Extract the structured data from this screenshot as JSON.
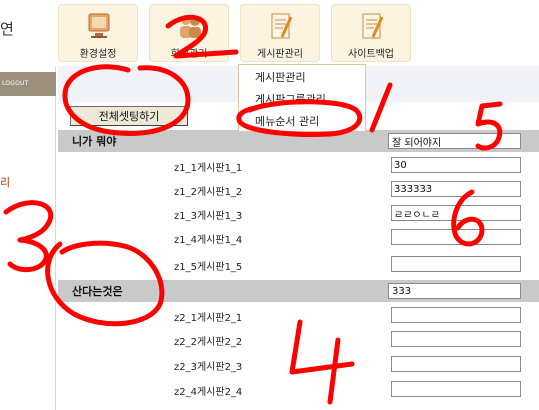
{
  "brand": {
    "char": "연"
  },
  "menu": [
    {
      "label": "환경설정",
      "icon": "monitor-icon"
    },
    {
      "label": "회원관리",
      "icon": "people-icon"
    },
    {
      "label": "게시판관리",
      "icon": "board-edit-icon"
    },
    {
      "label": "사이트백업",
      "icon": "backup-edit-icon"
    }
  ],
  "sidebar": {
    "logout": "LOGOUT",
    "partial_char": "리"
  },
  "dropdown": {
    "items": [
      "게시판관리",
      "게시판그룹관리",
      "메뉴순서 관리"
    ]
  },
  "setup_button": "전체셋팅하기",
  "groups": [
    {
      "name": "니가 뭐야",
      "value": "잘 되어야지",
      "items": [
        {
          "label": "z1_1게시판1_1",
          "value": "30"
        },
        {
          "label": "z1_2게시판1_2",
          "value": "333333"
        },
        {
          "label": "z1_3게시판1_3",
          "value": "ㄹㄹㅇㄴㄹ"
        },
        {
          "label": "z1_4게시판1_4",
          "value": ""
        },
        {
          "label": "z1_5게시판1_5",
          "value": ""
        }
      ]
    },
    {
      "name": "산다는것은",
      "value": "333",
      "items": [
        {
          "label": "z2_1게시판2_1",
          "value": ""
        },
        {
          "label": "z2_2게시판2_2",
          "value": ""
        },
        {
          "label": "z2_3게시판2_3",
          "value": ""
        },
        {
          "label": "z2_4게시판2_4",
          "value": ""
        }
      ]
    }
  ],
  "colors": {
    "tile_bg": "#fbf4e1",
    "group_bg": "#c9c9c9",
    "sidebar_header": "#9a8e7d",
    "annotation": "#ff0000"
  }
}
